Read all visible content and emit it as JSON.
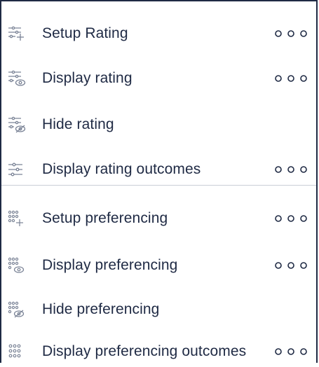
{
  "menu": {
    "items": [
      {
        "label": "Setup Rating",
        "icon": "sliders-plus-icon",
        "has_more": true
      },
      {
        "label": "Display rating",
        "icon": "sliders-eye-icon",
        "has_more": true
      },
      {
        "label": "Hide rating",
        "icon": "sliders-eye-off-icon",
        "has_more": false
      },
      {
        "label": "Display rating outcomes",
        "icon": "sliders-icon",
        "has_more": true
      },
      {
        "label": "Setup preferencing",
        "icon": "dot-grid-plus-icon",
        "has_more": true
      },
      {
        "label": "Display preferencing",
        "icon": "dot-grid-eye-icon",
        "has_more": true
      },
      {
        "label": "Hide preferencing",
        "icon": "dot-grid-eye-off-icon",
        "has_more": false
      },
      {
        "label": "Display preferencing outcomes",
        "icon": "dot-grid-icon",
        "has_more": true
      }
    ]
  },
  "colors": {
    "text": "#1f2a44",
    "icon": "#7a8396",
    "border": "#1f2a44",
    "divider": "#c9ced6"
  }
}
